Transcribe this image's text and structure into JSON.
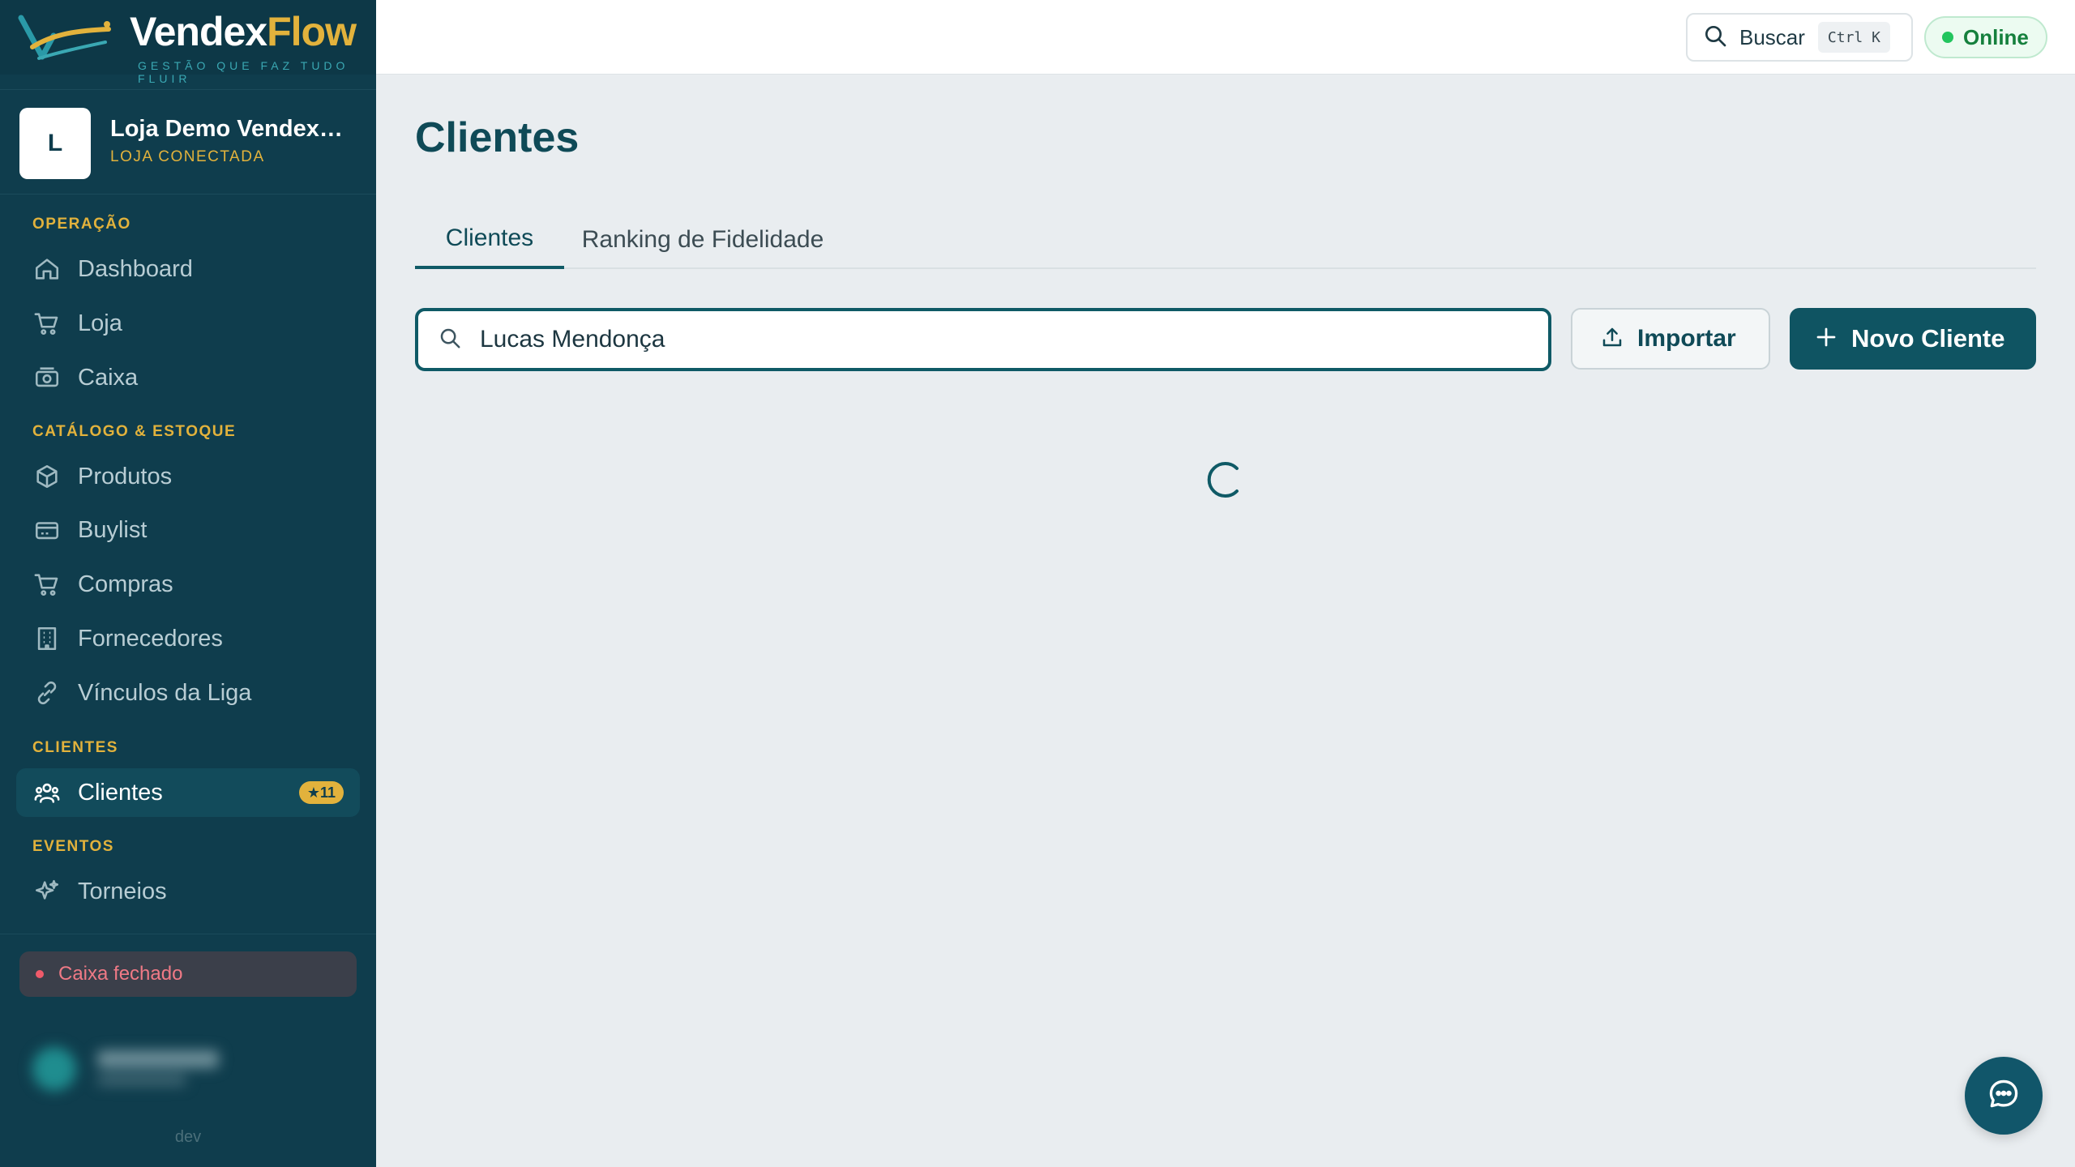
{
  "brand": {
    "name_main": "Vendex",
    "name_accent": "Flow",
    "tagline": "GESTÃO QUE FAZ TUDO FLUIR"
  },
  "store": {
    "avatar_letter": "L",
    "name": "Loja Demo VendexFlow",
    "status": "LOJA CONECTADA"
  },
  "sidebar": {
    "sections": {
      "operacao": "OPERAÇÃO",
      "catalogo": "CATÁLOGO & ESTOQUE",
      "clientes": "CLIENTES",
      "eventos": "EVENTOS"
    },
    "items": [
      {
        "label": "Dashboard",
        "icon": "home-icon"
      },
      {
        "label": "Loja",
        "icon": "cart-icon"
      },
      {
        "label": "Caixa",
        "icon": "cash-register-icon"
      },
      {
        "label": "Produtos",
        "icon": "box-icon"
      },
      {
        "label": "Buylist",
        "icon": "card-icon"
      },
      {
        "label": "Compras",
        "icon": "cart-icon"
      },
      {
        "label": "Fornecedores",
        "icon": "building-icon"
      },
      {
        "label": "Vínculos da Liga",
        "icon": "link-icon"
      },
      {
        "label": "Clientes",
        "icon": "users-icon",
        "active": true,
        "badge": "★11"
      },
      {
        "label": "Torneios",
        "icon": "sparkles-icon"
      }
    ],
    "cash_status": "Caixa fechado",
    "env": "dev"
  },
  "topbar": {
    "search_label": "Buscar",
    "shortcut": "Ctrl K",
    "status": "Online"
  },
  "main": {
    "title": "Clientes",
    "tabs": [
      {
        "label": "Clientes",
        "active": true
      },
      {
        "label": "Ranking de Fidelidade",
        "active": false
      }
    ],
    "search_value": "Lucas Mendonça",
    "import_label": "Importar",
    "new_label": "Novo Cliente"
  },
  "colors": {
    "sidebar_bg": "#0f3d4d",
    "accent": "#e2b23c",
    "primary": "#0f5462",
    "online": "#22c55e",
    "danger": "#f05a6a"
  }
}
